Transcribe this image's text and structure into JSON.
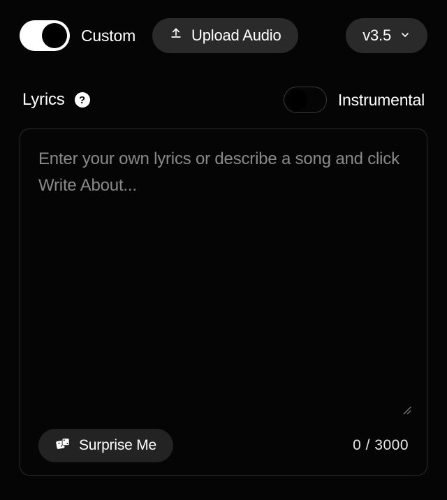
{
  "top": {
    "custom_label": "Custom",
    "custom_toggle_on": true,
    "upload_label": "Upload Audio",
    "version_label": "v3.5"
  },
  "lyrics": {
    "section_label": "Lyrics",
    "help_symbol": "?",
    "instrumental_label": "Instrumental",
    "instrumental_on": false,
    "placeholder": "Enter your own lyrics or describe a song and click Write About...",
    "value": "",
    "surprise_label": "Surprise Me",
    "counter_text": "0 / 3000"
  }
}
